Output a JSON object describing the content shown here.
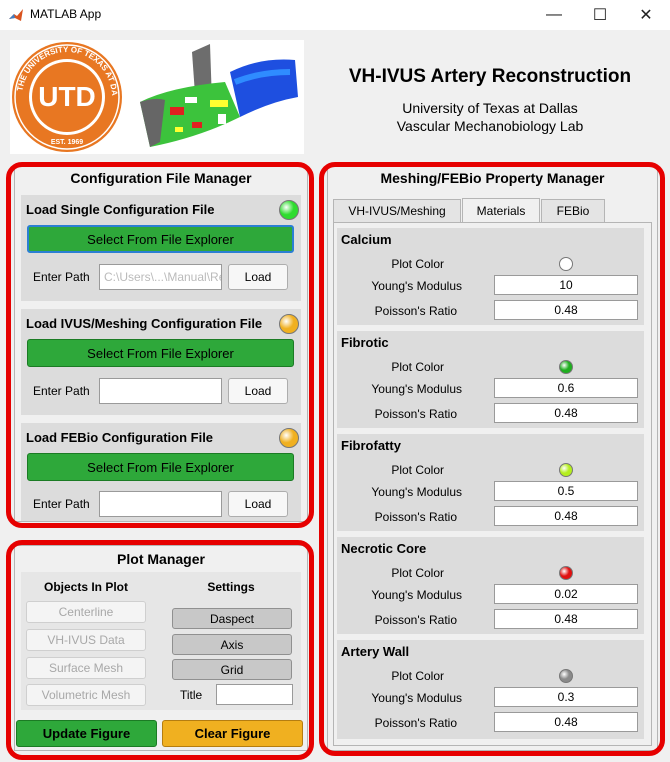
{
  "window": {
    "title": "MATLAB App",
    "minimize": "—",
    "maximize": "☐",
    "close": "✕"
  },
  "header": {
    "title": "VH-IVUS Artery Reconstruction",
    "line1": "University of Texas at Dallas",
    "line2": "Vascular Mechanobiology Lab",
    "seal_text": "UTD",
    "seal_year": "EST. 1969",
    "seal_ring": "THE UNIVERSITY OF TEXAS AT DALLAS"
  },
  "config": {
    "title": "Configuration File Manager",
    "sections": [
      {
        "title": "Load Single Configuration File",
        "button": "Select From File Explorer",
        "path_label": "Enter Path",
        "path_value": "C:\\Users\\...\\Manual\\Re",
        "load": "Load",
        "lamp_color": "#2fdc2f"
      },
      {
        "title": "Load IVUS/Meshing Configuration File",
        "button": "Select From File Explorer",
        "path_label": "Enter Path",
        "path_value": "",
        "load": "Load",
        "lamp_color": "#f0b020"
      },
      {
        "title": "Load FEBio Configuration File",
        "button": "Select From File Explorer",
        "path_label": "Enter Path",
        "path_value": "",
        "load": "Load",
        "lamp_color": "#f0b020"
      }
    ]
  },
  "plot": {
    "title": "Plot Manager",
    "objects_header": "Objects In Plot",
    "settings_header": "Settings",
    "objects": [
      "Centerline",
      "VH-IVUS Data",
      "Surface Mesh",
      "Volumetric Mesh"
    ],
    "settings": [
      "Daspect",
      "Axis",
      "Grid"
    ],
    "title_label": "Title",
    "title_value": "",
    "update": "Update Figure",
    "clear": "Clear Figure",
    "update_color": "#2ea83a",
    "clear_color": "#f0b020"
  },
  "meshing": {
    "title": "Meshing/FEBio Property Manager",
    "tabs": [
      "VH-IVUS/Meshing",
      "Materials",
      "FEBio"
    ],
    "active_tab": "Materials",
    "materials": [
      {
        "name": "Calcium",
        "color_label": "Plot Color",
        "modulus_label": "Young's Modulus",
        "modulus": "10",
        "poisson_label": "Poisson's Ratio",
        "poisson": "0.48",
        "color": "#ffffff"
      },
      {
        "name": "Fibrotic",
        "color_label": "Plot Color",
        "modulus_label": "Young's Modulus",
        "modulus": "0.6",
        "poisson_label": "Poisson's Ratio",
        "poisson": "0.48",
        "color": "#1fae1f"
      },
      {
        "name": "Fibrofatty",
        "color_label": "Plot Color",
        "modulus_label": "Young's Modulus",
        "modulus": "0.5",
        "poisson_label": "Poisson's Ratio",
        "poisson": "0.48",
        "color": "#b4ee1e"
      },
      {
        "name": "Necrotic Core",
        "color_label": "Plot Color",
        "modulus_label": "Young's Modulus",
        "modulus": "0.02",
        "poisson_label": "Poisson's Ratio",
        "poisson": "0.48",
        "color": "#e01010"
      },
      {
        "name": "Artery Wall",
        "color_label": "Plot Color",
        "modulus_label": "Young's Modulus",
        "modulus": "0.3",
        "poisson_label": "Poisson's Ratio",
        "poisson": "0.48",
        "color": "#8a8a8a"
      }
    ]
  }
}
